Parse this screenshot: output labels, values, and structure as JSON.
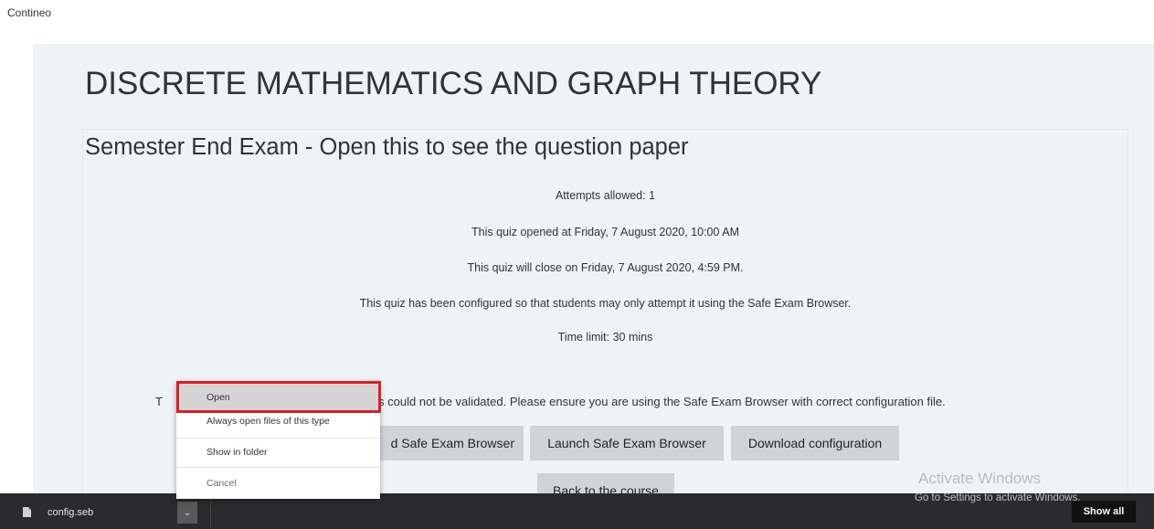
{
  "site": {
    "name": "Contineo"
  },
  "course": {
    "title": "DISCRETE MATHEMATICS AND GRAPH THEORY"
  },
  "quiz": {
    "title": "Semester End Exam - Open this to see the question paper",
    "attempts": "Attempts allowed: 1",
    "opened": "This quiz opened at Friday, 7 August 2020, 10:00 AM",
    "closes": "This quiz will close on Friday, 7 August 2020, 4:59 PM.",
    "seb_note": "This quiz has been configured so that students may only attempt it using the Safe Exam Browser.",
    "time_limit": "Time limit: 30 mins",
    "warning_prefix": "T",
    "warning_visible": "s could not be validated. Please ensure you are using the Safe Exam Browser with correct configuration file.",
    "buttons": {
      "download_seb": "d Safe Exam Browser",
      "launch_seb": "Launch Safe Exam Browser",
      "download_config": "Download configuration",
      "back": "Back to the course"
    }
  },
  "watermark": {
    "title": "Activate Windows",
    "subtitle": "Go to Settings to activate Windows."
  },
  "download_bar": {
    "file_name": "config.seb",
    "chevron": "⌄",
    "show_all": "Show all"
  },
  "context_menu": {
    "items": [
      "Open",
      "Always open files of this type",
      "Show in folder",
      "Cancel"
    ],
    "highlight_color": "#dc1e26"
  }
}
